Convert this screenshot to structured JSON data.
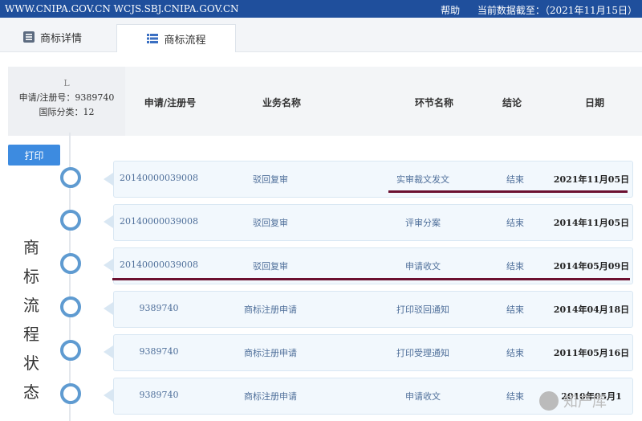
{
  "topbar": {
    "url": "WWW.CNIPA.GOV.CN WCJS.SBJ.CNIPA.GOV.CN",
    "help": "帮助",
    "data_date": "当前数据截至：（2021年11月15日）"
  },
  "tabs": [
    {
      "label": "商标详情"
    },
    {
      "label": "商标流程"
    }
  ],
  "summary": {
    "mark": "L",
    "reg_no": "申请/注册号：9389740",
    "class": "国际分类：12"
  },
  "table": {
    "headers": [
      "申请/注册号",
      "业务名称",
      "环节名称",
      "结论",
      "日期"
    ]
  },
  "print_label": "打印",
  "side_title": [
    "商",
    "标",
    "流",
    "程",
    "状",
    "态"
  ],
  "rows": [
    {
      "no": "20140000039008",
      "biz": "驳回复审",
      "step": "实审裁文发文",
      "result": "结束",
      "date": "2021年11月05日"
    },
    {
      "no": "20140000039008",
      "biz": "驳回复审",
      "step": "评审分案",
      "result": "结束",
      "date": "2014年11月05日"
    },
    {
      "no": "20140000039008",
      "biz": "驳回复审",
      "step": "申请收文",
      "result": "结束",
      "date": "2014年05月09日"
    },
    {
      "no": "9389740",
      "biz": "商标注册申请",
      "step": "打印驳回通知",
      "result": "结束",
      "date": "2014年04月18日"
    },
    {
      "no": "9389740",
      "biz": "商标注册申请",
      "step": "打印受理通知",
      "result": "结束",
      "date": "2011年05月16日"
    },
    {
      "no": "9389740",
      "biz": "商标注册申请",
      "step": "申请收文",
      "result": "结束",
      "date": "2010年05月1"
    }
  ],
  "watermark": "知产库",
  "colors": {
    "topbar": "#1f4f9c",
    "circle": "#5f9bd1",
    "underline": "#6b1030",
    "button": "#3d8be0"
  }
}
